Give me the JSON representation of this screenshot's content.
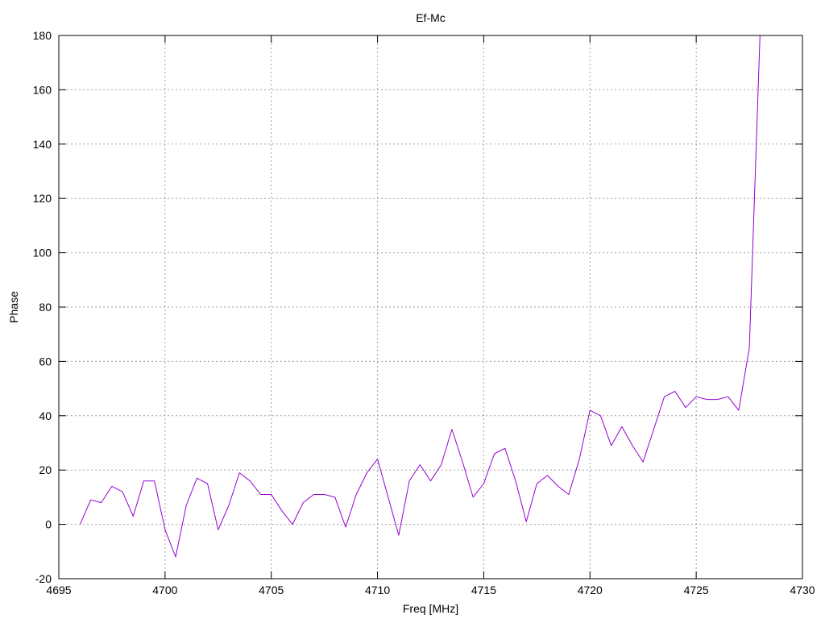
{
  "chart_data": {
    "type": "line",
    "title": "Ef-Mc",
    "xlabel": "Freq [MHz]",
    "ylabel": "Phase",
    "xlim": [
      4695,
      4730
    ],
    "ylim": [
      -20,
      180
    ],
    "xticks": [
      4695,
      4700,
      4705,
      4710,
      4715,
      4720,
      4725,
      4730
    ],
    "yticks": [
      -20,
      0,
      20,
      40,
      60,
      80,
      100,
      120,
      140,
      160,
      180
    ],
    "grid": true,
    "series": [
      {
        "color": "#9400d3",
        "x": [
          4696.0,
          4696.5,
          4697.0,
          4697.5,
          4698.0,
          4698.5,
          4699.0,
          4699.5,
          4700.0,
          4700.5,
          4701.0,
          4701.5,
          4702.0,
          4702.5,
          4703.0,
          4703.5,
          4704.0,
          4704.5,
          4705.0,
          4705.5,
          4706.0,
          4706.5,
          4707.0,
          4707.5,
          4708.0,
          4708.5,
          4709.0,
          4709.5,
          4710.0,
          4710.5,
          4711.0,
          4711.5,
          4712.0,
          4712.5,
          4713.0,
          4713.5,
          4714.0,
          4714.5,
          4715.0,
          4715.5,
          4716.0,
          4716.5,
          4717.0,
          4717.5,
          4718.0,
          4718.5,
          4719.0,
          4719.5,
          4720.0,
          4720.5,
          4721.0,
          4721.5,
          4722.0,
          4722.5,
          4723.0,
          4723.5,
          4724.0,
          4724.5,
          4725.0,
          4725.5,
          4726.0,
          4726.5,
          4727.0,
          4727.5,
          4728.0
        ],
        "y": [
          0,
          9,
          8,
          14,
          12,
          3,
          16,
          16,
          -2,
          -12,
          7,
          17,
          15,
          -2,
          7,
          19,
          16,
          11,
          11,
          5,
          0,
          8,
          11,
          11,
          10,
          -1,
          11,
          19,
          24,
          10,
          -4,
          16,
          22,
          16,
          22,
          35,
          23,
          10,
          15,
          26,
          28,
          16,
          1,
          15,
          18,
          14,
          11,
          24,
          42,
          40,
          29,
          36,
          29,
          23,
          35,
          47,
          49,
          43,
          47,
          46,
          46,
          47,
          42,
          65,
          180
        ]
      }
    ]
  }
}
